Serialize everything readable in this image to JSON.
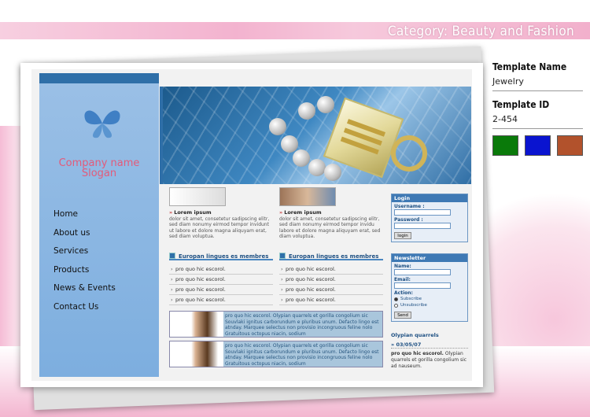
{
  "category": "Category: Beauty and Fashion",
  "template": {
    "name_label": "Template Name",
    "name_value": "Jewelry",
    "id_label": "Template ID",
    "id_value": "2-454",
    "swatches": [
      "#0a7a0a",
      "#0a14d0",
      "#b2522c"
    ]
  },
  "preview": {
    "company": "Company name",
    "slogan": "Slogan",
    "nav": [
      "Home",
      "About us",
      "Services",
      "Products",
      "News & Events",
      "Contact Us"
    ],
    "col1": {
      "title": "Lorem ipsum",
      "text": "dolor sit amet, consetetur sadipscing elitr, sed diam nonumy eirmod tempor invidunt ut labore et dolore magna aliquyam erat, sed diam voluptua."
    },
    "col2": {
      "title": "Lorem ipsum",
      "text": "dolor sit amet, consetetur sadipscing elitr, sed diam nonumy eirmod tempor invidu labore et dolore magna aliquyam erat, sed diam voluptua."
    },
    "section1": "Europan lingues es membres",
    "section2": "Europan lingues es membres",
    "list_item": "pro quo hic escorol.",
    "news_text": "pro quo hic escorol. Olypian quarrels et gorilla congolium sic Souvlaki ignitus carborundum e pluribus unum. Defacto lingo est atnday. Marquee selectus non provisio incongruous feline nolo Gratuitous octopus niacin, sodium",
    "login": {
      "title": "Login",
      "username": "Username :",
      "password": "Password :",
      "button": "login"
    },
    "newsletter": {
      "title": "Newsletter",
      "name": "Name:",
      "email": "Email:",
      "action": "Action:",
      "subscribe": "Subscribe",
      "unsubscribe": "Unsubscribe",
      "button": "Send"
    },
    "side_title": "Olypian quarrels",
    "side_date": "» 03/05/07",
    "side_text_bold": "pro quo hic escorol.",
    "side_text": " Olypian quarrels et gorilla congolium sic ad nauseum."
  }
}
